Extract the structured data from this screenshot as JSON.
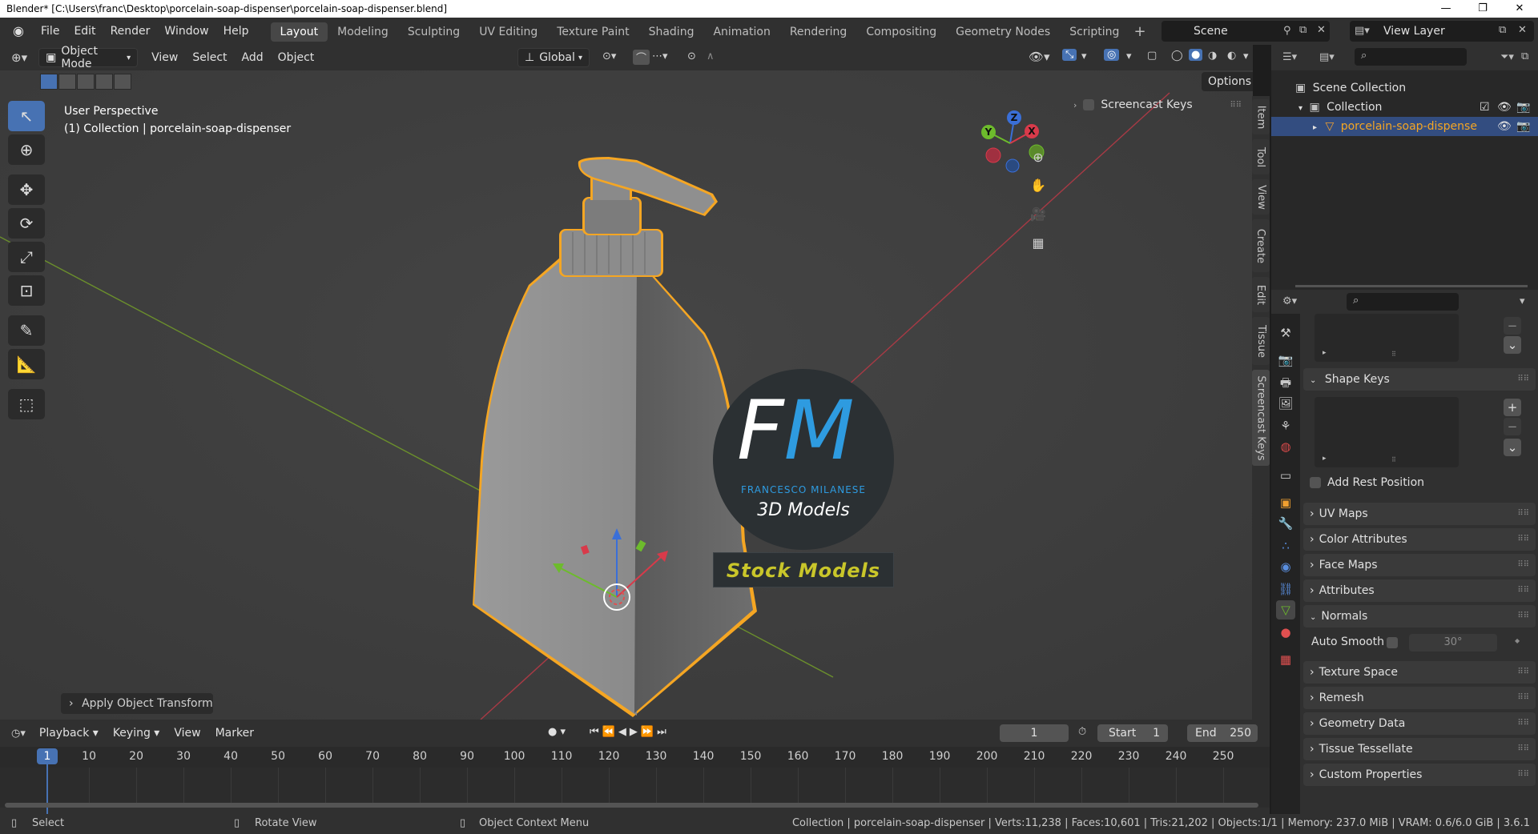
{
  "window": {
    "title": "Blender* [C:\\Users\\franc\\Desktop\\porcelain-soap-dispenser\\porcelain-soap-dispenser.blend]",
    "controls": [
      "—",
      "❐",
      "✕"
    ]
  },
  "menu": [
    "File",
    "Edit",
    "Render",
    "Window",
    "Help"
  ],
  "workspaces": [
    "Layout",
    "Modeling",
    "Sculpting",
    "UV Editing",
    "Texture Paint",
    "Shading",
    "Animation",
    "Rendering",
    "Compositing",
    "Geometry Nodes",
    "Scripting"
  ],
  "active_workspace": "Layout",
  "scene": "Scene",
  "view_layer": "View Layer",
  "viewport": {
    "mode": "Object Mode",
    "menus": [
      "View",
      "Select",
      "Add",
      "Object"
    ],
    "transform_orientation": "Global",
    "options_label": "Options",
    "info_line1": "User Perspective",
    "info_line2": "(1) Collection | porcelain-soap-dispenser",
    "screencast_keys": "Screencast Keys",
    "sidebar_tabs": [
      "Item",
      "Tool",
      "View",
      "Create",
      "Edit",
      "Tissue",
      "Screencast Keys"
    ],
    "last_operator": "Apply Object Transform",
    "gizmo_axes": {
      "x": "X",
      "y": "Y",
      "z": "Z"
    }
  },
  "watermark": {
    "initials_f": "F",
    "initials_m": "M",
    "name": "FRANCESCO MILANESE",
    "subtitle": "3D Models",
    "banner": "Stock Models"
  },
  "timeline": {
    "menus": [
      "Playback",
      "Keying",
      "View",
      "Marker"
    ],
    "current_frame": "1",
    "start_label": "Start",
    "start": "1",
    "end_label": "End",
    "end": "250",
    "frame_labels": [
      "10",
      "20",
      "30",
      "40",
      "50",
      "60",
      "70",
      "80",
      "90",
      "100",
      "110",
      "120",
      "130",
      "140",
      "150",
      "160",
      "170",
      "180",
      "190",
      "200",
      "210",
      "220",
      "230",
      "240",
      "250"
    ]
  },
  "outliner": {
    "scene_collection": "Scene Collection",
    "collection": "Collection",
    "object": "porcelain-soap-dispense"
  },
  "properties": {
    "sections": {
      "shape_keys": "Shape Keys",
      "add_rest_position": "Add Rest Position",
      "uv_maps": "UV Maps",
      "color_attributes": "Color Attributes",
      "face_maps": "Face Maps",
      "attributes": "Attributes",
      "normals": "Normals",
      "auto_smooth": "Auto Smooth",
      "auto_smooth_angle": "30°",
      "texture_space": "Texture Space",
      "remesh": "Remesh",
      "geometry_data": "Geometry Data",
      "tissue_tessellate": "Tissue Tessellate",
      "custom_properties": "Custom Properties"
    }
  },
  "status": {
    "select": "Select",
    "rotate": "Rotate View",
    "context_menu": "Object Context Menu",
    "stats": "Collection | porcelain-soap-dispenser | Verts:11,238 | Faces:10,601 | Tris:21,202 | Objects:1/1 | Memory: 237.0 MiB | VRAM: 0.6/6.0 GiB | 3.6.1"
  },
  "colors": {
    "accent": "#4772b3",
    "selection_outline": "#f5a623",
    "grid_y_axis": "#6b8f2c",
    "grid_x_axis": "#a83a45",
    "banner_text": "#c9c62a",
    "logo_m": "#2e9be0"
  }
}
